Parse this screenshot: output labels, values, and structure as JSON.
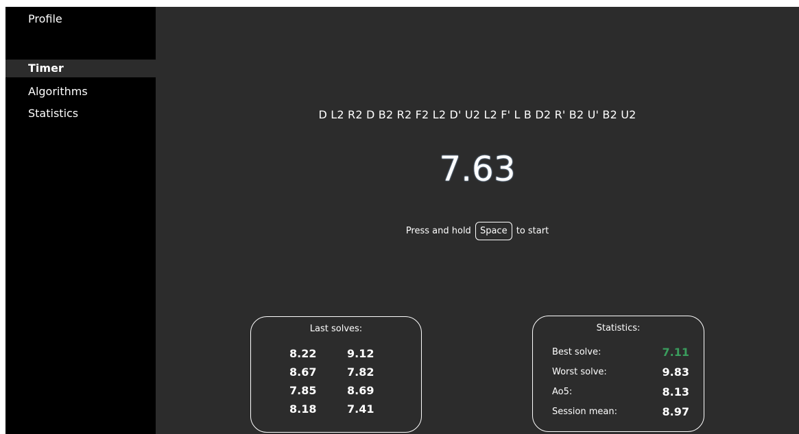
{
  "sidebar": {
    "profile": "Profile",
    "items": [
      {
        "label": "Timer"
      },
      {
        "label": "Algorithms"
      },
      {
        "label": "Statistics"
      }
    ]
  },
  "timer": {
    "scramble": "D L2 R2 D B2 R2 F2 L2 D' U2 L2 F' L B D2 R' B2 U' B2 U2",
    "time": "7.63",
    "hint_before": "Press and hold",
    "hint_key": "Space",
    "hint_after": "to start"
  },
  "last_solves": {
    "title": "Last solves:",
    "values": [
      "8.22",
      "9.12",
      "8.67",
      "7.82",
      "7.85",
      "8.69",
      "8.18",
      "7.41"
    ]
  },
  "statistics": {
    "title": "Statistics:",
    "rows": [
      {
        "label": "Best solve:",
        "value": "7.11",
        "color": "#3a9d5d"
      },
      {
        "label": "Worst solve:",
        "value": "9.83",
        "color": "#ffffff"
      },
      {
        "label": "Ao5:",
        "value": "8.13",
        "color": "#ffffff"
      },
      {
        "label": "Session mean:",
        "value": "8.97",
        "color": "#ffffff"
      }
    ]
  },
  "colors": {
    "sidebar_bg": "#000000",
    "main_bg": "#2c2c2c",
    "best_accent": "#3a9d5d"
  }
}
